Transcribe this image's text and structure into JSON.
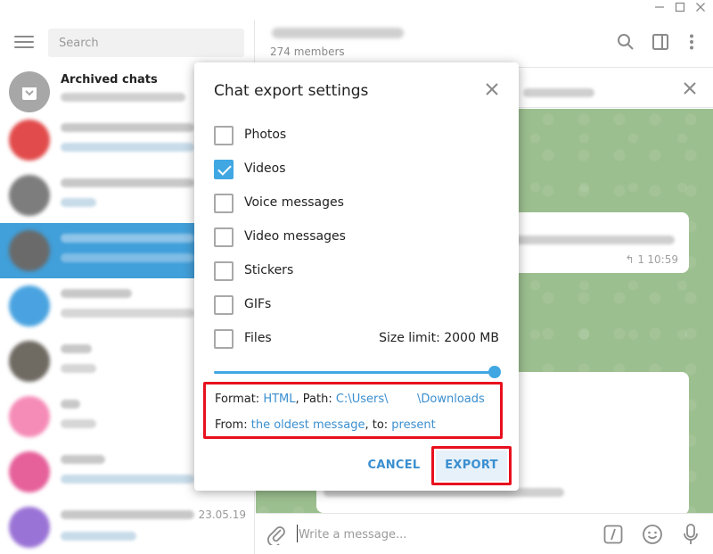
{
  "colors": {
    "accent": "#40a7e3",
    "active_row": "#419fd9",
    "highlight_red": "#e8101e",
    "chat_background": "#9cbf8f"
  },
  "window": {
    "minimize_icon": "minimize-icon",
    "maximize_icon": "maximize-icon",
    "close_icon": "close-icon"
  },
  "sidebar": {
    "search_placeholder": "Search",
    "items": [
      {
        "name": "Archived chats",
        "date": "",
        "avatar_color": "#a7a7a7"
      },
      {
        "name": "",
        "date": "",
        "avatar_color": "#e24b4b"
      },
      {
        "name": "",
        "date": "",
        "avatar_color": "#7d7d7d"
      },
      {
        "name": "",
        "date": "",
        "avatar_color": "#6a6a6a"
      },
      {
        "name": "",
        "date": "",
        "avatar_color": "#4aa3e0"
      },
      {
        "name": "",
        "date": "",
        "avatar_color": "#6f6a62"
      },
      {
        "name": "",
        "date": "",
        "avatar_color": "#f58cb8"
      },
      {
        "name": "",
        "date": "",
        "avatar_color": "#e6609a"
      },
      {
        "name": "",
        "date": "23.05.19",
        "avatar_color": "#9a73d6"
      }
    ]
  },
  "chat": {
    "members": "274 members",
    "message_time": "10:59",
    "reply_count": "1",
    "composer_placeholder": "Write a message..."
  },
  "dialog": {
    "title": "Chat export settings",
    "options": [
      {
        "label": "Photos",
        "checked": false
      },
      {
        "label": "Videos",
        "checked": true
      },
      {
        "label": "Voice messages",
        "checked": false
      },
      {
        "label": "Video messages",
        "checked": false
      },
      {
        "label": "Stickers",
        "checked": false
      },
      {
        "label": "GIFs",
        "checked": false
      },
      {
        "label": "Files",
        "checked": false
      }
    ],
    "size_limit": "Size limit: 2000 MB",
    "size_slider_fraction": 1.0,
    "format_label": "Format: ",
    "format_value": "HTML",
    "path_label": ", Path: ",
    "path_start": "C:\\Users\\",
    "path_end": "\\Downloads",
    "from_label": "From: ",
    "from_value": "the oldest message",
    "to_label": ", to: ",
    "to_value": "present",
    "cancel_label": "CANCEL",
    "export_label": "EXPORT"
  }
}
